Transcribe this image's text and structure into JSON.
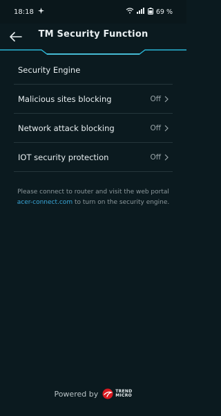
{
  "statusbar": {
    "time": "18:18",
    "battery": "69 %"
  },
  "header": {
    "title": "TM Security Function"
  },
  "settings": [
    {
      "label": "Security Engine",
      "value": ""
    },
    {
      "label": "Malicious sites blocking",
      "value": "Off"
    },
    {
      "label": "Network attack blocking",
      "value": "Off"
    },
    {
      "label": "IOT security protection",
      "value": "Off"
    }
  ],
  "note": {
    "pre": "Please connect to router and visit the web portal ",
    "link": "acer-connect.com",
    "post": " to turn on the security engine."
  },
  "footer": {
    "powered_by": "Powered by",
    "brand_line1": "TREND",
    "brand_line2": "MICRO"
  },
  "colors": {
    "accent": "#2bb6d6",
    "background": "#0b1a1f",
    "link": "#3aa7d8",
    "brand_red": "#d71920"
  },
  "icons": [
    "back-arrow-icon",
    "chevron-right-icon",
    "wifi-icon",
    "signal-icon",
    "battery-icon",
    "trend-micro-logo-icon"
  ]
}
